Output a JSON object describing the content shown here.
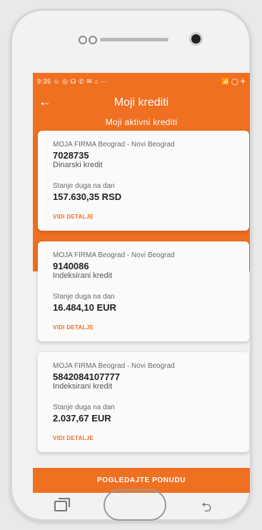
{
  "status_bar": {
    "time_icons": "9:35 ☺ ◎ ☊ ✆ ✉ ⌂ ⋯",
    "right_icons": "📶 ◯ ✈"
  },
  "header": {
    "back_icon": "←",
    "title": "Moji krediti",
    "subtitle": "Moji aktivni krediti"
  },
  "loans": [
    {
      "company": "MOJA FIRMA Beograd - Novi Beograd",
      "number": "7028735",
      "type": "Dinarski kredit",
      "balance_label": "Stanje duga na dan",
      "amount": "157.630,35 RSD",
      "details_label": "VIDI DETALJE"
    },
    {
      "company": "MOJA FIRMA Beograd - Novi Beograd",
      "number": "9140086",
      "type": "Indeksirani kredit",
      "balance_label": "Stanje duga na dan",
      "amount": "16.484,10 EUR",
      "details_label": "VIDI DETALJE"
    },
    {
      "company": "MOJA FIRMA Beograd - Novi Beograd",
      "number": "5842084107777",
      "type": "Indeksirani kredit",
      "balance_label": "Stanje duga na dan",
      "amount": "2.037,67 EUR",
      "details_label": "VIDI DETALJE"
    }
  ],
  "cta": {
    "label": "POGLEDAJTE PONUDU"
  },
  "colors": {
    "accent": "#f07021",
    "card": "#fafafa"
  }
}
